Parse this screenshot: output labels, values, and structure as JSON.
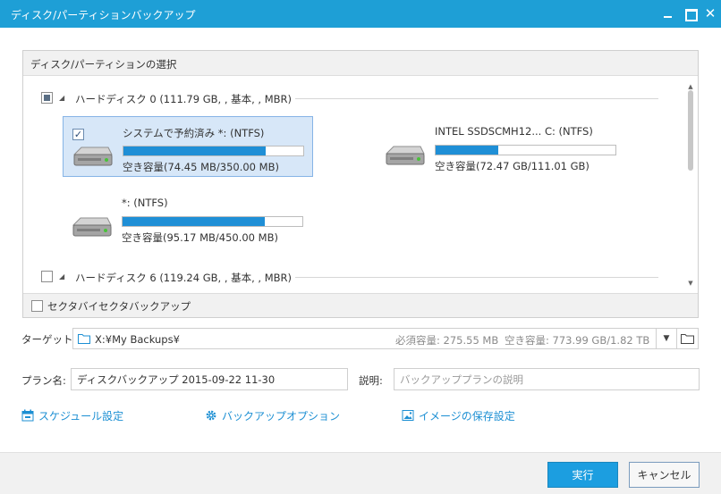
{
  "window": {
    "title": "ディスク/パーティションバックアップ",
    "minimize_label": "",
    "close_glyph": "✕"
  },
  "disk_panel": {
    "header": "ディスク/パーティションの選択",
    "disks": [
      {
        "label": "ハードディスク 0 (111.79 GB, , 基本, , MBR)",
        "checkbox_state": "partial",
        "partitions": [
          {
            "name": "システムで予約済み *: (NTFS)",
            "free": "空き容量(74.45 MB/350.00 MB)",
            "used_fraction": 0.79,
            "checked": true,
            "selected": true
          },
          {
            "name": "INTEL SSDSCMH12... C: (NTFS)",
            "free": "空き容量(72.47 GB/111.01 GB)",
            "used_fraction": 0.35,
            "checked": false,
            "selected": false
          },
          {
            "name": "*: (NTFS)",
            "free": "空き容量(95.17 MB/450.00 MB)",
            "used_fraction": 0.79,
            "checked": false,
            "selected": false
          }
        ]
      },
      {
        "label": "ハードディスク 6 (119.24 GB, , 基本, , MBR)",
        "checkbox_state": "unchecked",
        "partitions": []
      }
    ],
    "sector_backup_label": "セクタバイセクタバックアップ"
  },
  "target": {
    "label": "ターゲット:",
    "path": "X:¥My Backups¥",
    "required": "必須容量: 275.55 MB",
    "free": "空き容量: 773.99 GB/1.82 TB"
  },
  "plan": {
    "label": "プラン名:",
    "value": "ディスクバックアップ 2015-09-22 11-30"
  },
  "description": {
    "label": "説明:",
    "placeholder": "バックアッププランの説明"
  },
  "links": {
    "schedule": "スケジュール設定",
    "backup_options": "バックアップオプション",
    "image_storage": "イメージの保存設定"
  },
  "buttons": {
    "execute": "実行",
    "cancel": "キャンセル"
  },
  "colors": {
    "titlebar": "#1e9fd6",
    "accent": "#1c9ee0",
    "bar_fill": "#1f8fd6",
    "selection": "#d7e7f8"
  }
}
